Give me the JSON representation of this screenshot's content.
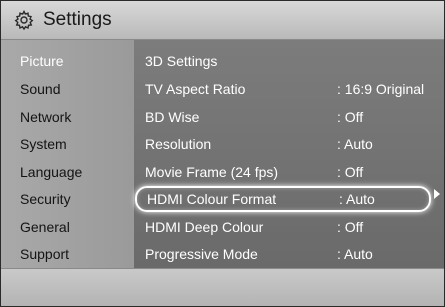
{
  "header": {
    "title": "Settings",
    "icon": "gear-icon"
  },
  "sidebar": {
    "items": [
      {
        "label": "Picture",
        "active": true
      },
      {
        "label": "Sound"
      },
      {
        "label": "Network"
      },
      {
        "label": "System"
      },
      {
        "label": "Language"
      },
      {
        "label": "Security"
      },
      {
        "label": "General"
      },
      {
        "label": "Support"
      }
    ]
  },
  "main": {
    "rows": [
      {
        "label": "3D Settings",
        "value": ""
      },
      {
        "label": "TV Aspect Ratio",
        "value": ": 16:9 Original"
      },
      {
        "label": "BD Wise",
        "value": ": Off"
      },
      {
        "label": "Resolution",
        "value": ": Auto"
      },
      {
        "label": "Movie Frame (24 fps)",
        "value": ": Off"
      },
      {
        "label": "HDMI Colour Format",
        "value": ": Auto",
        "selected": true
      },
      {
        "label": "HDMI Deep Colour",
        "value": ": Off"
      },
      {
        "label": "Progressive Mode",
        "value": ": Auto"
      }
    ]
  },
  "colors": {
    "active_text": "#ffffff",
    "sidebar_bg": "#a3a3a3",
    "content_bg": "#737373",
    "header_bg": "#c8c8c8"
  }
}
